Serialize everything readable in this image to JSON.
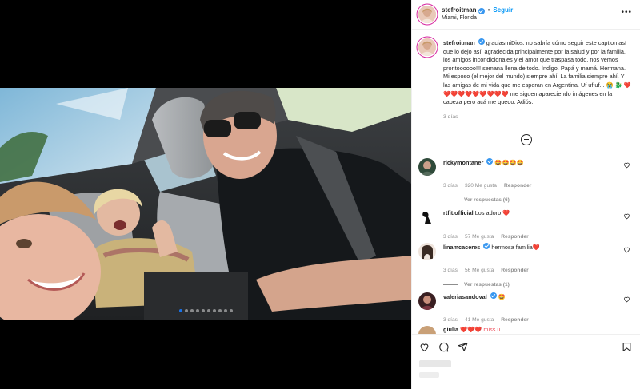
{
  "header": {
    "username": "stefroitman",
    "separator": "•",
    "follow_label": "Seguir",
    "location": "Miami, Florida",
    "more_label": "•••"
  },
  "caption": {
    "username": "stefroitman",
    "text": "graciasmiDios. no sabría cómo seguir este caption así que lo dejo así. agradecida principalmente por la salud y por la familia. los amigos incondicionales y el amor que traspasa todo. nos vemos prontoooooo!!! semana llena de todo. Índigo. Papá y mamá. Hermana. Mi esposo (el mejor del mundo) siempre ahí. La familia siempre ahí. Y las amigas de mi vida que me esperan en Argentina. Uf uf uf...",
    "emoji_tail": "😭 🐉 ❤️❤️❤️❤️❤️❤️❤️❤️❤️❤️",
    "text_after": " me siguen apareciendo imágenes en la cabeza pero acá me quedo. Adiós.",
    "time": "3 días"
  },
  "comments": [
    {
      "username": "rickymontaner",
      "verified": true,
      "text": "🤩🤩🤩🤩",
      "time": "3 días",
      "likes": "320 Me gusta",
      "reply_label": "Responder",
      "view_replies": "Ver respuestas (6)"
    },
    {
      "username": "rtfit.official",
      "verified": false,
      "text": "Los adoro ❤️",
      "time": "3 días",
      "likes": "57 Me gusta",
      "reply_label": "Responder",
      "view_replies": ""
    },
    {
      "username": "linamcaceres",
      "verified": true,
      "text": "hermosa familia❤️",
      "time": "3 días",
      "likes": "56 Me gusta",
      "reply_label": "Responder",
      "view_replies": "Ver respuestas (1)"
    },
    {
      "username": "valeriasandoval",
      "verified": true,
      "text": "🤩",
      "time": "3 días",
      "likes": "41 Me gusta",
      "reply_label": "Responder",
      "view_replies": ""
    },
    {
      "username": "giulia",
      "verified": false,
      "text": "❤️❤️❤️ miss u",
      "time": "",
      "likes": "",
      "reply_label": "",
      "view_replies": ""
    }
  ],
  "actions": {
    "like_icon": "heart-icon",
    "comment_icon": "comment-icon",
    "share_icon": "share-icon",
    "save_icon": "bookmark-icon"
  },
  "carousel": {
    "total": 10,
    "active_index": 0
  },
  "colors": {
    "accent": "#0095f6",
    "verified": "#3897f0",
    "heart": "#ed4956",
    "muted": "#8e8e8e"
  }
}
